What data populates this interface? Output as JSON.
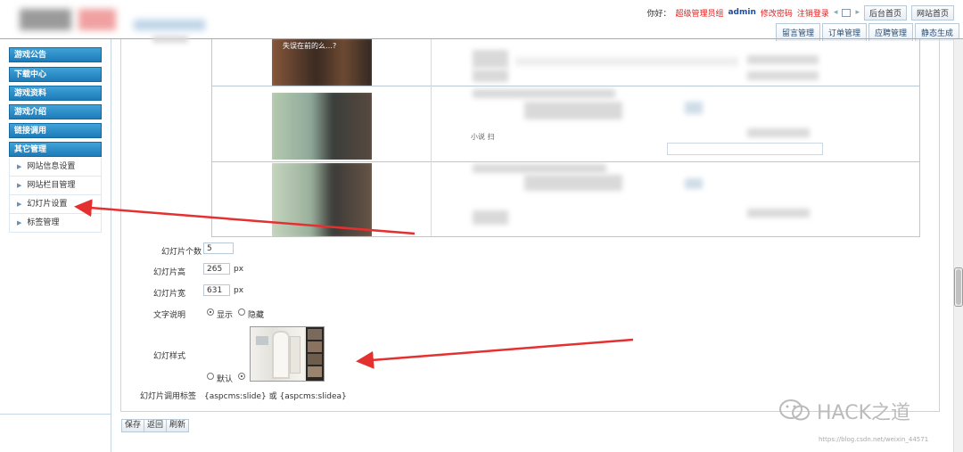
{
  "header": {
    "greeting": "你好：",
    "group": "超级管理员组",
    "user": "admin",
    "change_password": "修改密码",
    "logout": "注销登录",
    "backend_home": "后台首页",
    "site_home": "网站首页"
  },
  "tabs": [
    "留言管理",
    "订单管理",
    "应聘管理",
    "静态生成"
  ],
  "sidebar": {
    "sections": [
      "游戏公告",
      "下载中心",
      "游戏资料",
      "游戏介绍",
      "链接调用",
      "其它管理"
    ],
    "items": [
      "网站信息设置",
      "网站栏目管理",
      "幻灯片设置",
      "标签管理"
    ]
  },
  "form": {
    "slide_count_label": "幻灯片个数",
    "slide_count": "5",
    "slide_height_label": "幻灯片高",
    "slide_height": "265",
    "slide_width_label": "幻灯片宽",
    "slide_width": "631",
    "unit": "px",
    "text_desc_label": "文字说明",
    "show": "显示",
    "hide": "隐藏",
    "style_label": "幻灯样式",
    "default": "默认",
    "tag_label": "幻灯片调用标签",
    "tag_value": "{aspcms:slide} 或 {aspcms:slidea}"
  },
  "buttons": [
    "保存",
    "返回",
    "刷新"
  ],
  "thumb_text": "失误在前的么…?",
  "row_text": "小说 扫",
  "watermark": "HACK之道",
  "watermark_url": "https://blog.csdn.net/weixin_44571"
}
